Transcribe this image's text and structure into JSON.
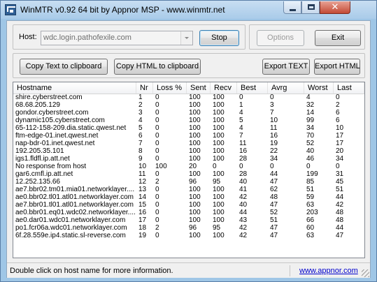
{
  "window": {
    "title": "WinMTR v0.92 64 bit by Appnor MSP - www.winmtr.net",
    "close_glyph": "✕",
    "icons": {
      "app": "winmtr-app-icon",
      "minimize": "minimize-icon",
      "maximize": "maximize-icon",
      "close": "close-icon"
    }
  },
  "toolbar": {
    "host_label": "Host:",
    "host_value": "wdc.login.pathofexile.com",
    "stop_label": "Stop",
    "options_label": "Options",
    "exit_label": "Exit",
    "copy_text_label": "Copy Text to clipboard",
    "copy_html_label": "Copy HTML to clipboard",
    "export_text_label": "Export TEXT",
    "export_html_label": "Export HTML"
  },
  "table": {
    "columns": [
      "Hostname",
      "Nr",
      "Loss %",
      "Sent",
      "Recv",
      "Best",
      "Avrg",
      "Worst",
      "Last"
    ],
    "rows": [
      [
        "shire.cyberstreet.com",
        "1",
        "0",
        "100",
        "100",
        "0",
        "0",
        "4",
        "0"
      ],
      [
        "68.68.205.129",
        "2",
        "0",
        "100",
        "100",
        "1",
        "3",
        "32",
        "2"
      ],
      [
        "gondor.cyberstreet.com",
        "3",
        "0",
        "100",
        "100",
        "4",
        "7",
        "14",
        "6"
      ],
      [
        "dynamic105.cyberstreet.com",
        "4",
        "0",
        "100",
        "100",
        "5",
        "10",
        "99",
        "6"
      ],
      [
        "65-112-158-209.dia.static.qwest.net",
        "5",
        "0",
        "100",
        "100",
        "4",
        "11",
        "34",
        "10"
      ],
      [
        "ftm-edge-01.inet.qwest.net",
        "6",
        "0",
        "100",
        "100",
        "7",
        "16",
        "70",
        "17"
      ],
      [
        "nap-bdr-01.inet.qwest.net",
        "7",
        "0",
        "100",
        "100",
        "11",
        "19",
        "52",
        "17"
      ],
      [
        "192.205.35.101",
        "8",
        "0",
        "100",
        "100",
        "16",
        "22",
        "40",
        "20"
      ],
      [
        "igs1.fldfl.ip.att.net",
        "9",
        "0",
        "100",
        "100",
        "28",
        "34",
        "46",
        "34"
      ],
      [
        "No response from host",
        "10",
        "100",
        "20",
        "0",
        "0",
        "0",
        "0",
        "0"
      ],
      [
        "gar6.cmfl.ip.att.net",
        "11",
        "0",
        "100",
        "100",
        "28",
        "44",
        "199",
        "31"
      ],
      [
        "12.252.135.66",
        "12",
        "2",
        "96",
        "95",
        "40",
        "47",
        "85",
        "45"
      ],
      [
        "ae7.bbr02.tm01.mia01.networklayer....",
        "13",
        "0",
        "100",
        "100",
        "41",
        "62",
        "51",
        "51"
      ],
      [
        "ae0.bbr02.tl01.atl01.networklayer.com",
        "14",
        "0",
        "100",
        "100",
        "42",
        "48",
        "59",
        "44"
      ],
      [
        "ae7.bbr01.tl01.atl01.networklayer.com",
        "15",
        "0",
        "100",
        "100",
        "40",
        "47",
        "63",
        "42"
      ],
      [
        "ae0.bbr01.eq01.wdc02.networklayer....",
        "16",
        "0",
        "100",
        "100",
        "44",
        "52",
        "203",
        "48"
      ],
      [
        "ae0.dar01.wdc01.networklayer.com",
        "17",
        "0",
        "100",
        "100",
        "43",
        "51",
        "66",
        "48"
      ],
      [
        "po1.fcr06a.wdc01.networklayer.com",
        "18",
        "2",
        "96",
        "95",
        "42",
        "47",
        "60",
        "44"
      ],
      [
        "6f.28.559e.ip4.static.sl-reverse.com",
        "19",
        "0",
        "100",
        "100",
        "42",
        "47",
        "63",
        "47"
      ]
    ]
  },
  "status": {
    "text": "Double click on host name for more information.",
    "link": "www.appnor.com"
  }
}
